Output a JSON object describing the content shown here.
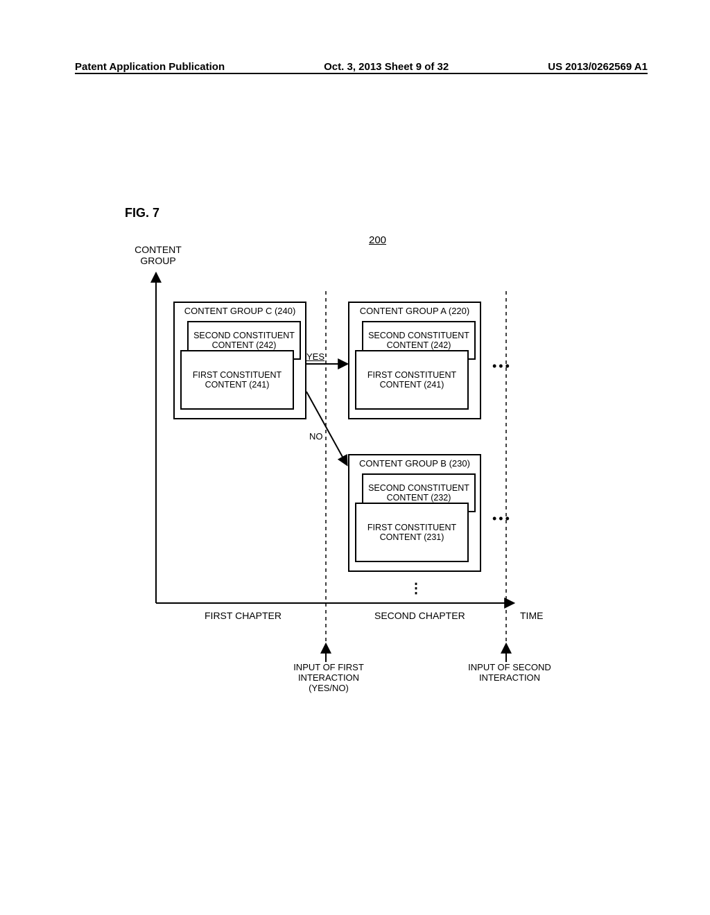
{
  "header": {
    "left": "Patent Application Publication",
    "center": "Oct. 3, 2013   Sheet 9 of 32",
    "right": "US 2013/0262569 A1"
  },
  "figure_label": "FIG. 7",
  "ref_num": "200",
  "axis": {
    "y": "CONTENT\nGROUP",
    "x": "TIME",
    "chapter1": "FIRST CHAPTER",
    "chapter2": "SECOND CHAPTER",
    "input1": "INPUT OF FIRST\nINTERACTION\n(YES/NO)",
    "input2": "INPUT OF SECOND\nINTERACTION"
  },
  "branches": {
    "yes": "YES",
    "no": "NO"
  },
  "groups": {
    "C": {
      "title": "CONTENT GROUP C (240)",
      "second": "SECOND CONSTITUENT\nCONTENT (242)",
      "first": "FIRST CONSTITUENT\nCONTENT (241)"
    },
    "A": {
      "title": "CONTENT GROUP A (220)",
      "second": "SECOND CONSTITUENT\nCONTENT (242)",
      "first": "FIRST CONSTITUENT\nCONTENT (241)"
    },
    "B": {
      "title": "CONTENT GROUP B (230)",
      "second": "SECOND CONSTITUENT\nCONTENT (232)",
      "first": "FIRST CONSTITUENT\nCONTENT (231)"
    }
  },
  "ellipsis": "•••",
  "vellipsis": "⋮"
}
